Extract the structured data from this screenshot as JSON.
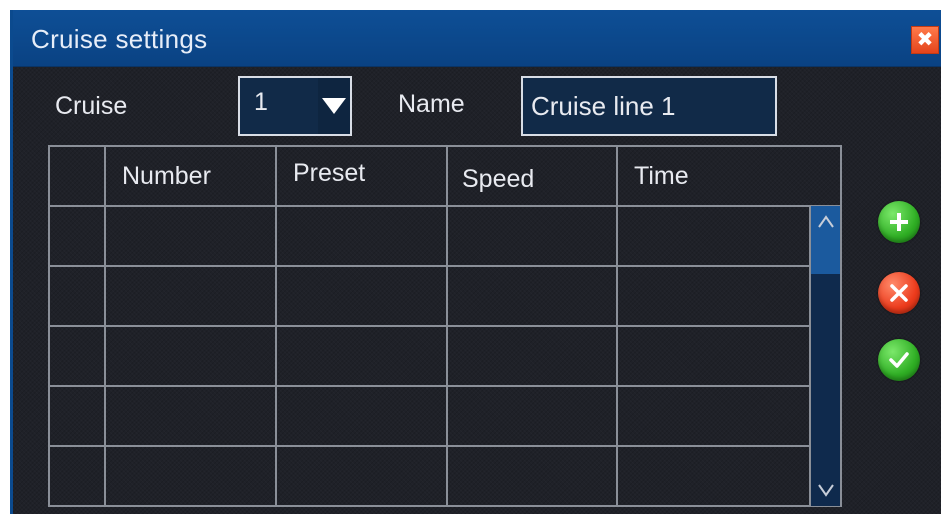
{
  "window": {
    "title": "Cruise settings"
  },
  "form": {
    "cruise_label": "Cruise",
    "cruise_value": "1",
    "name_label": "Name",
    "name_value": "Cruise line 1"
  },
  "table": {
    "columns": [
      "",
      "Number",
      "Preset",
      "Speed",
      "Time"
    ],
    "rows": [
      [
        "",
        "",
        "",
        "",
        ""
      ],
      [
        "",
        "",
        "",
        "",
        ""
      ],
      [
        "",
        "",
        "",
        "",
        ""
      ],
      [
        "",
        "",
        "",
        "",
        ""
      ],
      [
        "",
        "",
        "",
        "",
        ""
      ]
    ]
  },
  "icons": {
    "close": "close-icon",
    "add": "plus-icon",
    "delete": "x-icon",
    "confirm": "checkmark-icon",
    "dropdown": "triangle-down-icon",
    "scroll_up": "chevron-up-icon",
    "scroll_down": "chevron-down-icon"
  },
  "colors": {
    "titlebar": "#0e4f96",
    "background": "#1f2128",
    "input_bg": "#112a48",
    "grid_line": "#8a8f98",
    "add_button": "#2fae24",
    "delete_button": "#ec3b1c",
    "confirm_button": "#2fae24",
    "close_button": "#e3441c"
  }
}
